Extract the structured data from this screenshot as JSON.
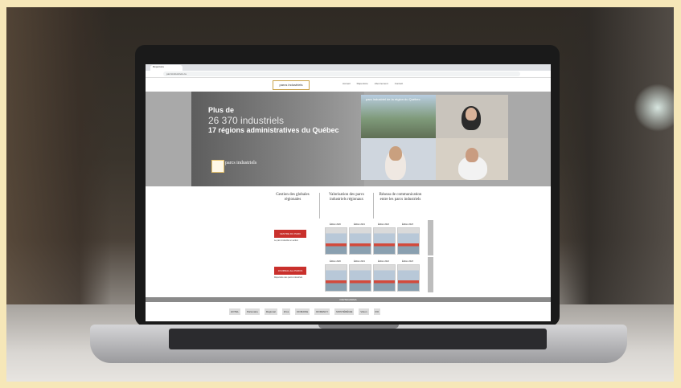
{
  "browser": {
    "tab_title": "Répertoire",
    "url": "parcsindustriels.ca"
  },
  "site": {
    "logo": "parcs industriels",
    "menu": [
      "Accueil",
      "Répertoire",
      "Abonnement",
      "Contact"
    ]
  },
  "hero": {
    "line1": "Plus de",
    "line2": "26 370 industriels",
    "line3": "17 régions administratives du Québec",
    "logo_text": "parcs industriels",
    "video_caption": "parc industriel de la région du Québec"
  },
  "columns": [
    "Gestion des globales régionales",
    "Valorisation des parcs industriels régionaux",
    "Réseau de communication entre les parcs industriels"
  ],
  "publications": [
    {
      "badge": "CENTRE DU PARC INDUSTRIEL",
      "subtitle": "Le parc industriel en action"
    },
    {
      "badge": "JOURNAL des PARCS INDUSTRIELS",
      "subtitle": "Répertoire des parcs industriels"
    }
  ],
  "magazines_row1": [
    "Édition 2020",
    "Édition 2021",
    "Édition 2022",
    "Édition 2023"
  ],
  "magazines_row2": [
    "Édition 2020",
    "Édition 2021",
    "Édition 2022",
    "Édition 2023"
  ],
  "partners_label": "PARTENAIRES",
  "partners": [
    "HOTEL",
    "Partenaire",
    "Régional",
    "Infos",
    "DOMAINE",
    "RORENCY",
    "MONTÉRÉGIE",
    "Vision",
    "RO"
  ]
}
